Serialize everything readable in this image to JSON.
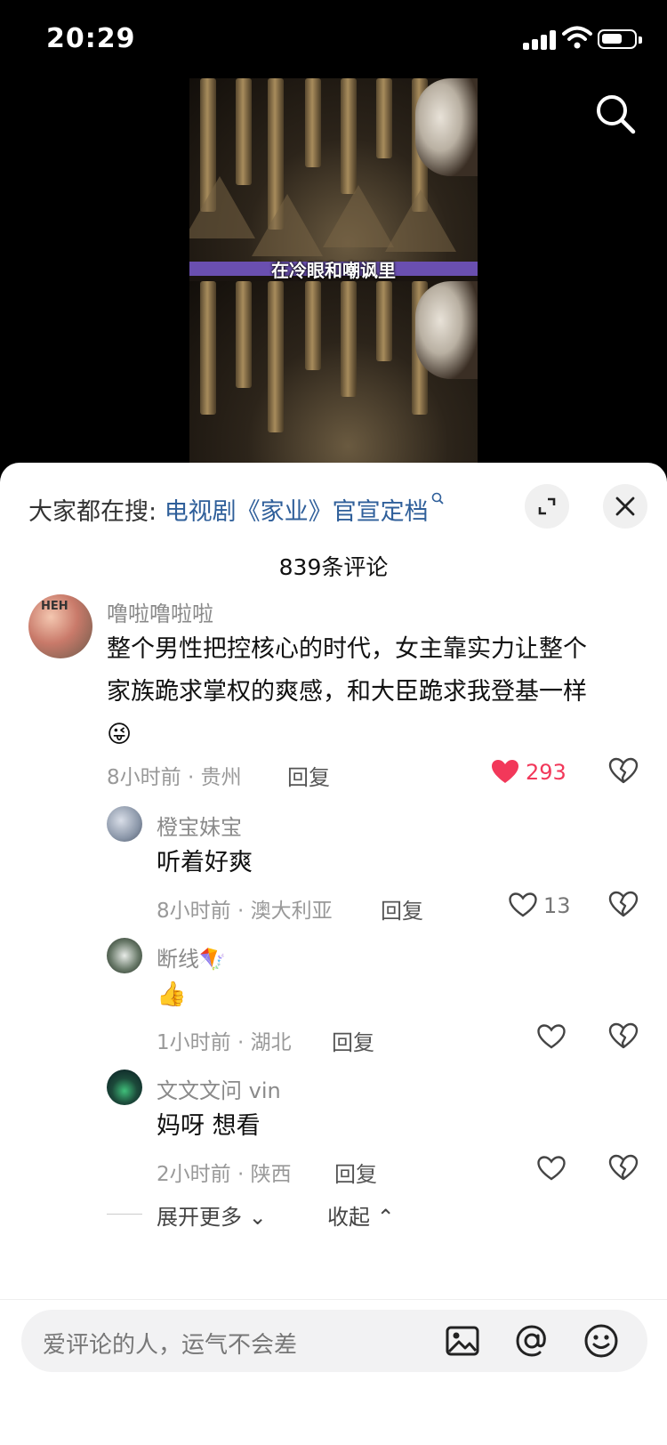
{
  "status_bar": {
    "time": "20:29"
  },
  "video": {
    "subtitle": "在冷眼和嘲讽里"
  },
  "panel": {
    "hot_search_prefix": "大家都在搜: ",
    "hot_search_topic": "电视剧《家业》官宣定档",
    "comment_count": "839条评论"
  },
  "comments": [
    {
      "user": "噜啦噜啦啦",
      "text_line1": "整个男性把控核心的时代，女主靠实力让整个",
      "text_line2": "家族跪求掌权的爽感，和大臣跪求我登基一样",
      "emoji": "😜",
      "meta": "8小时前 · 贵州",
      "reply": "回复",
      "likes": "293",
      "liked": true
    },
    {
      "user": "橙宝妹宝",
      "text": "听着好爽",
      "meta": "8小时前 · 澳大利亚",
      "reply": "回复",
      "likes": "13"
    },
    {
      "user": "断线🪁",
      "text": "👍",
      "meta": "1小时前 · 湖北",
      "reply": "回复"
    },
    {
      "user": "文文文问 vin",
      "text": "妈呀 想看",
      "meta": "2小时前 · 陕西",
      "reply": "回复"
    }
  ],
  "actions": {
    "expand_more": "展开更多",
    "collapse": "收起"
  },
  "input": {
    "placeholder": "爱评论的人，运气不会差"
  },
  "colors": {
    "like_red": "#f2385a",
    "topic_blue": "#2f5f9a",
    "subtitle_purple": "#6a4fb0"
  },
  "icons": [
    "search-icon",
    "expand-icon",
    "close-icon",
    "heart-icon",
    "broken-heart-icon",
    "image-icon",
    "at-icon",
    "emoji-icon"
  ]
}
